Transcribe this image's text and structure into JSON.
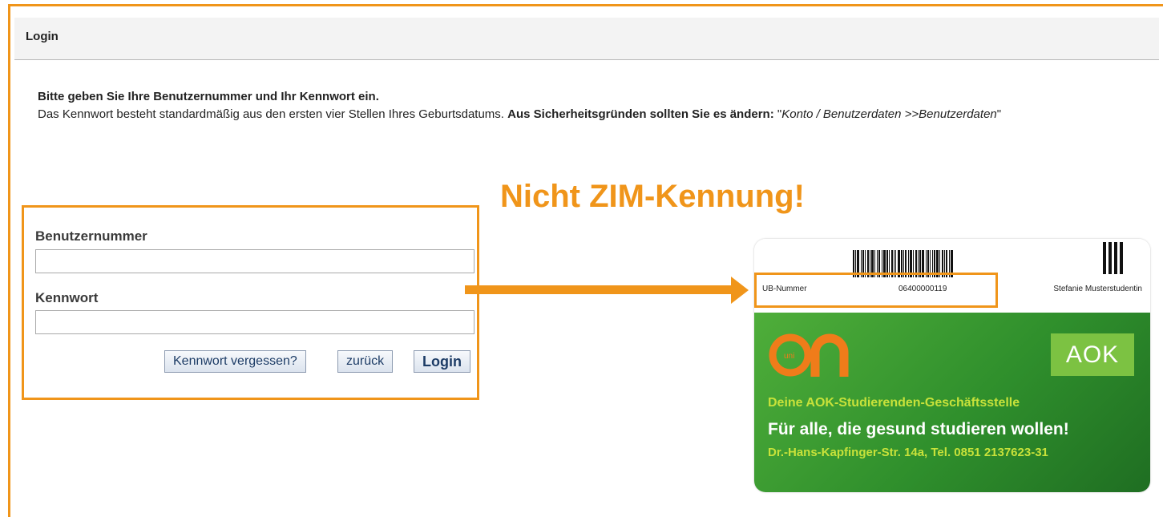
{
  "header": {
    "title": "Login"
  },
  "intro": {
    "line1": "Bitte geben Sie Ihre Benutzernummer und Ihr Kennwort ein.",
    "line2_plain": "Das Kennwort besteht standardmäßig aus den ersten vier Stellen Ihres Geburtsdatums. ",
    "line2_bold": "Aus Sicherheitsgründen sollten Sie es ändern: ",
    "line2_quote_open": "\"",
    "line2_italic": "Konto / Benutzerdaten >>Benutzerdaten",
    "line2_quote_close": "\""
  },
  "callout": {
    "text": "Nicht ZIM-Kennung!"
  },
  "form": {
    "username_label": "Benutzernummer",
    "username_value": "",
    "password_label": "Kennwort",
    "password_value": "",
    "forgot_label": "Kennwort vergessen?",
    "back_label": "zurück",
    "login_label": "Login"
  },
  "card": {
    "ub_label": "UB-Nummer",
    "ub_number": "06400000119",
    "student_name": "Stefanie Musterstudentin",
    "logo_uni": "uni",
    "logo_on": "on",
    "aok_logo": "AOK",
    "line1": "Deine AOK-Studierenden-Geschäftsstelle",
    "line2": "Für alle, die gesund studieren wollen!",
    "line3": "Dr.-Hans-Kapfinger-Str. 14a, Tel. 0851 2137623-31"
  },
  "colors": {
    "accent": "#f0951a",
    "card_green": "#2f8f2c",
    "card_lime": "#c8e23a"
  }
}
